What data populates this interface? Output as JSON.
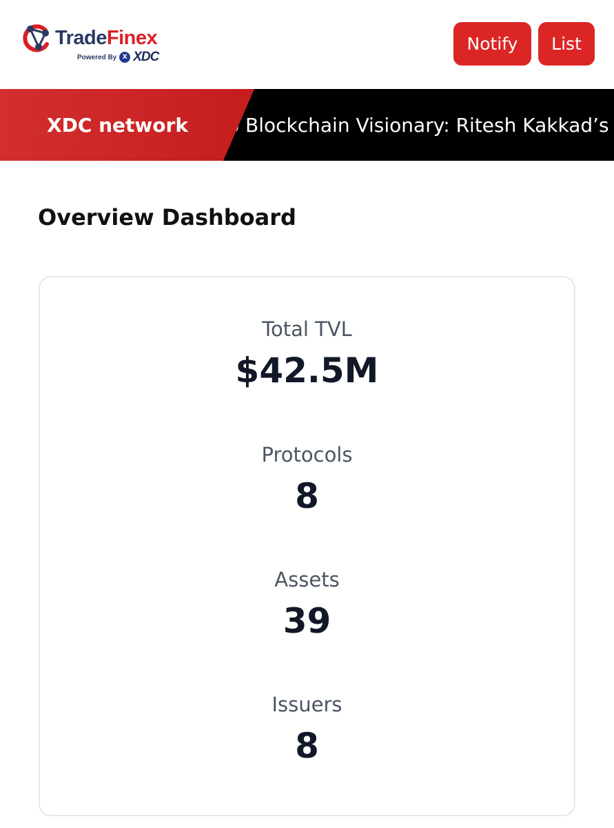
{
  "header": {
    "logo": {
      "name_part1": "Trade",
      "name_part2": "Finex",
      "powered_by": "Powered By",
      "network_mark": "XDC",
      "network_icon_letter": "X",
      "icon": "tradefinex-logo-mark"
    },
    "buttons": {
      "notify_label": "Notify",
      "list_label": "List"
    }
  },
  "ticker": {
    "label": "XDC network",
    "headline": "o Blockchain Visionary: Ritesh Kakkad’s"
  },
  "main": {
    "title": "Overview Dashboard",
    "stats": [
      {
        "label": "Total TVL",
        "value": "$42.5M"
      },
      {
        "label": "Protocols",
        "value": "8"
      },
      {
        "label": "Assets",
        "value": "39"
      },
      {
        "label": "Issuers",
        "value": "8"
      }
    ]
  },
  "colors": {
    "brand_red": "#dc2626",
    "brand_navy": "#2b3a63",
    "ticker_background": "#000000",
    "text_primary": "#111827",
    "text_muted": "#4b5563"
  }
}
